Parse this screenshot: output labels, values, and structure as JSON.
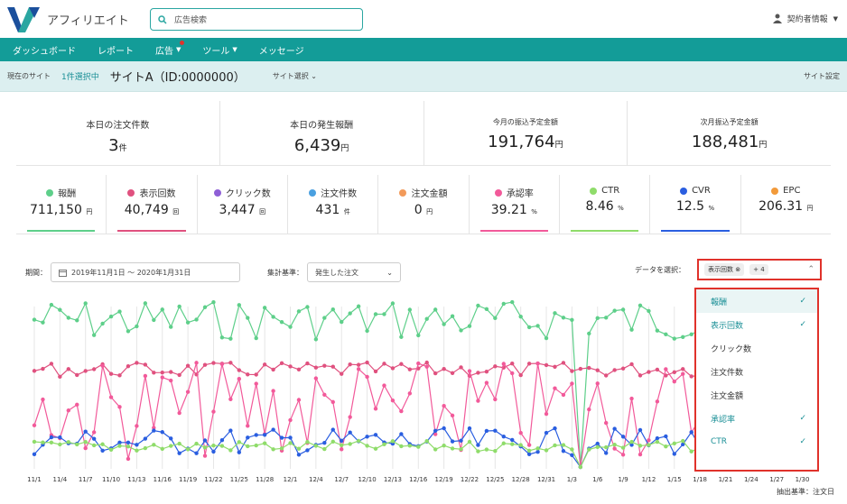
{
  "app": {
    "name": "アフィリエイト"
  },
  "search": {
    "placeholder": "広告検索"
  },
  "account": {
    "label": "契約者情報"
  },
  "nav": {
    "items": [
      {
        "label": "ダッシュボード"
      },
      {
        "label": "レポート"
      },
      {
        "label": "広告"
      },
      {
        "label": "ツール"
      },
      {
        "label": "メッセージ"
      }
    ]
  },
  "site_bar": {
    "current_label": "現在のサイト",
    "selected": "1件選択中",
    "site_name": "サイトA（ID:0000000）",
    "site_select": "サイト選択",
    "site_settings": "サイト設定"
  },
  "summary": [
    {
      "label": "本日の注文件数",
      "value": "3",
      "unit": "件"
    },
    {
      "label": "本日の発生報酬",
      "value": "6,439",
      "unit": "円"
    },
    {
      "label": "今月の振込予定金額",
      "value": "191,764",
      "unit": "円"
    },
    {
      "label": "次月振込予定金額",
      "value": "188,481",
      "unit": "円"
    }
  ],
  "metrics": [
    {
      "label": "報酬",
      "value": "711,150",
      "unit": "円",
      "color": "#5ecf8a",
      "active": true
    },
    {
      "label": "表示回数",
      "value": "40,749",
      "unit": "回",
      "color": "#e0517f",
      "active": true
    },
    {
      "label": "クリック数",
      "value": "3,447",
      "unit": "回",
      "color": "#8e5fd6",
      "active": false
    },
    {
      "label": "注文件数",
      "value": "431",
      "unit": "件",
      "color": "#4aa0e0",
      "active": false
    },
    {
      "label": "注文金額",
      "value": "0",
      "unit": "円",
      "color": "#f29a5a",
      "active": false
    },
    {
      "label": "承認率",
      "value": "39.21",
      "unit": "%",
      "color": "#f25a9a",
      "active": true
    },
    {
      "label": "CTR",
      "value": "8.46",
      "unit": "%",
      "color": "#8fdc6a",
      "active": true
    },
    {
      "label": "CVR",
      "value": "12.5",
      "unit": "%",
      "color": "#2a5ee0",
      "active": true
    },
    {
      "label": "EPC",
      "value": "206.31",
      "unit": "円",
      "color": "#f29a3a",
      "active": false
    }
  ],
  "controls": {
    "period_label": "期間：",
    "period_value": "2019年11月1日 〜 2020年1月31日",
    "basis_label": "集計基準：",
    "basis_value": "発生した注文",
    "data_select_label": "データを選択：",
    "chip": "表示回数",
    "more": "+ 4"
  },
  "dropdown": {
    "items": [
      {
        "label": "報酬",
        "checked": true
      },
      {
        "label": "表示回数",
        "checked": true
      },
      {
        "label": "クリック数",
        "checked": false
      },
      {
        "label": "注文件数",
        "checked": false
      },
      {
        "label": "注文金額",
        "checked": false
      },
      {
        "label": "承認率",
        "checked": true
      },
      {
        "label": "CTR",
        "checked": true
      }
    ]
  },
  "chart": {
    "x_ticks": [
      "11/1",
      "11/4",
      "11/7",
      "11/10",
      "11/13",
      "11/16",
      "11/19",
      "11/22",
      "11/25",
      "11/28",
      "12/1",
      "12/4",
      "12/7",
      "12/10",
      "12/13",
      "12/16",
      "12/19",
      "12/22",
      "12/25",
      "12/28",
      "12/31",
      "1/3",
      "1/6",
      "1/9",
      "1/12",
      "1/15",
      "1/18",
      "1/21",
      "1/24",
      "1/27",
      "1/30"
    ]
  },
  "footer": {
    "basis": "抽出基準：注文日"
  }
}
